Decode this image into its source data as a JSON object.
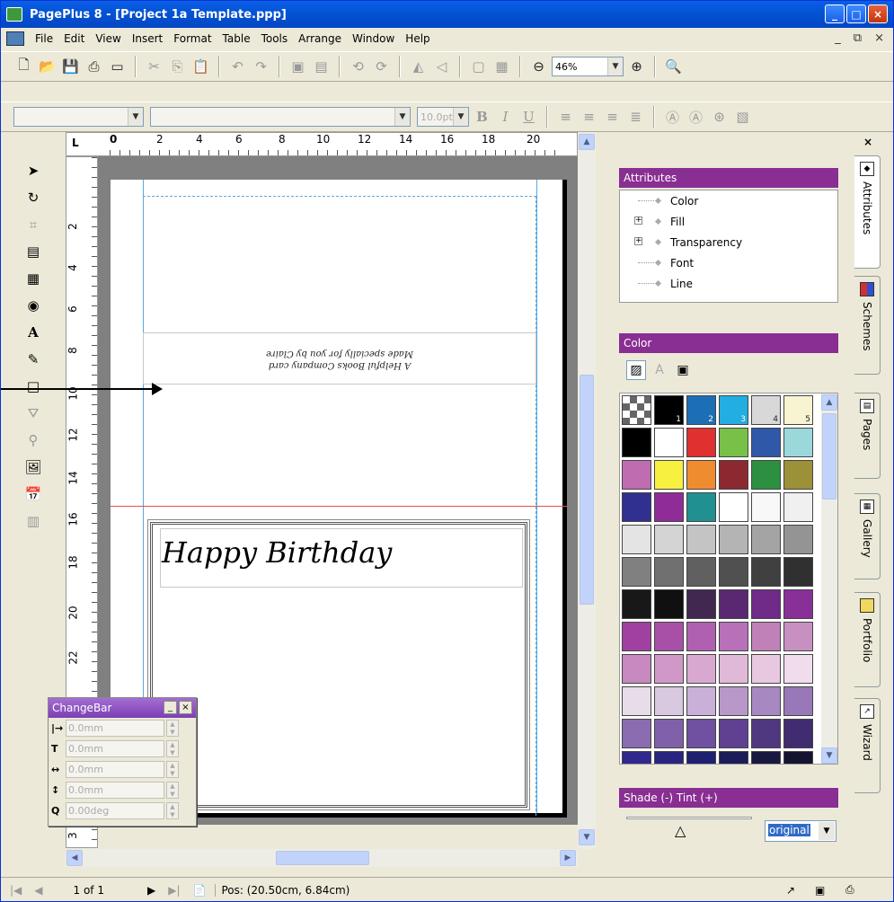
{
  "window": {
    "title": "PagePlus 8 - [Project 1a Template.ppp]",
    "btn_min": "_",
    "btn_max": "□",
    "btn_close": "×"
  },
  "menu": {
    "items": [
      "File",
      "Edit",
      "View",
      "Insert",
      "Format",
      "Table",
      "Tools",
      "Arrange",
      "Window",
      "Help"
    ],
    "right_min": "_",
    "right_restore": "⧉",
    "right_close": "×"
  },
  "toolbar": {
    "zoom": "46%"
  },
  "format_bar": {
    "font_size": "10.0pt",
    "bold": "B",
    "italic": "I",
    "underline": "U"
  },
  "ruler": {
    "h": [
      "0",
      "2",
      "4",
      "6",
      "8",
      "10",
      "12",
      "14",
      "16",
      "18",
      "20"
    ],
    "v": [
      "2",
      "4",
      "6",
      "8",
      "10",
      "12",
      "14",
      "16",
      "18",
      "20",
      "22",
      "3"
    ],
    "corner": "L"
  },
  "document": {
    "small_text_line1": "A Helpful Books Company card",
    "small_text_line2": "Made specially for you by Claire",
    "heading": "Happy Birthday"
  },
  "changebar": {
    "title": "ChangeBar",
    "fields": [
      {
        "icon": "|→",
        "value": "0.0mm"
      },
      {
        "icon": "T",
        "value": "0.0mm"
      },
      {
        "icon": "↔",
        "value": "0.0mm"
      },
      {
        "icon": "↕",
        "value": "0.0mm"
      },
      {
        "icon": "Q",
        "value": "0.00deg"
      }
    ]
  },
  "attributes_panel": {
    "title": "Attributes",
    "items": [
      "Color",
      "Fill",
      "Transparency",
      "Font",
      "Line"
    ]
  },
  "color_panel": {
    "title": "Color",
    "swatches": [
      {
        "c": "#808080",
        "n": ""
      },
      {
        "c": "#000000",
        "n": "1"
      },
      {
        "c": "#1c6fb5",
        "n": "2"
      },
      {
        "c": "#22aee0",
        "n": "3"
      },
      {
        "c": "#d8d8d8",
        "n": "4"
      },
      {
        "c": "#f8f3d0",
        "n": "5"
      },
      {
        "c": "#000000",
        "n": ""
      },
      {
        "c": "#ffffff",
        "n": ""
      },
      {
        "c": "#e03030",
        "n": ""
      },
      {
        "c": "#78c048",
        "n": ""
      },
      {
        "c": "#2f58a8",
        "n": ""
      },
      {
        "c": "#9ad8dc",
        "n": ""
      },
      {
        "c": "#c06cb0",
        "n": ""
      },
      {
        "c": "#f8f040",
        "n": ""
      },
      {
        "c": "#f08c30",
        "n": ""
      },
      {
        "c": "#8c2830",
        "n": ""
      },
      {
        "c": "#2c9040",
        "n": ""
      },
      {
        "c": "#9c9038",
        "n": ""
      },
      {
        "c": "#303090",
        "n": ""
      },
      {
        "c": "#902c98",
        "n": ""
      },
      {
        "c": "#209090",
        "n": ""
      },
      {
        "c": "#ffffff",
        "n": ""
      },
      {
        "c": "#f8f8f8",
        "n": ""
      },
      {
        "c": "#f0f0f0",
        "n": ""
      },
      {
        "c": "#e4e4e4",
        "n": ""
      },
      {
        "c": "#d4d4d4",
        "n": ""
      },
      {
        "c": "#c4c4c4",
        "n": ""
      },
      {
        "c": "#b4b4b4",
        "n": ""
      },
      {
        "c": "#a4a4a4",
        "n": ""
      },
      {
        "c": "#949494",
        "n": ""
      },
      {
        "c": "#808080",
        "n": ""
      },
      {
        "c": "#707070",
        "n": ""
      },
      {
        "c": "#606060",
        "n": ""
      },
      {
        "c": "#505050",
        "n": ""
      },
      {
        "c": "#404040",
        "n": ""
      },
      {
        "c": "#303030",
        "n": ""
      },
      {
        "c": "#181818",
        "n": ""
      },
      {
        "c": "#101010",
        "n": ""
      },
      {
        "c": "#402850",
        "n": ""
      },
      {
        "c": "#5a2870",
        "n": ""
      },
      {
        "c": "#702a88",
        "n": ""
      },
      {
        "c": "#883098",
        "n": ""
      },
      {
        "c": "#a040a0",
        "n": ""
      },
      {
        "c": "#a850a8",
        "n": ""
      },
      {
        "c": "#b060b0",
        "n": ""
      },
      {
        "c": "#b870b8",
        "n": ""
      },
      {
        "c": "#c080b8",
        "n": ""
      },
      {
        "c": "#c890c0",
        "n": ""
      },
      {
        "c": "#c888c0",
        "n": ""
      },
      {
        "c": "#d098c8",
        "n": ""
      },
      {
        "c": "#d8a8d0",
        "n": ""
      },
      {
        "c": "#e0b8d8",
        "n": ""
      },
      {
        "c": "#e8c8e0",
        "n": ""
      },
      {
        "c": "#f0dcec",
        "n": ""
      },
      {
        "c": "#e8dce8",
        "n": ""
      },
      {
        "c": "#d8c8e0",
        "n": ""
      },
      {
        "c": "#c8b0d8",
        "n": ""
      },
      {
        "c": "#b898c8",
        "n": ""
      },
      {
        "c": "#a888c0",
        "n": ""
      },
      {
        "c": "#9878b8",
        "n": ""
      },
      {
        "c": "#8c6cb0",
        "n": ""
      },
      {
        "c": "#8060a8",
        "n": ""
      },
      {
        "c": "#7050a0",
        "n": ""
      },
      {
        "c": "#604090",
        "n": ""
      },
      {
        "c": "#503880",
        "n": ""
      },
      {
        "c": "#402c70",
        "n": ""
      },
      {
        "c": "#30288c",
        "n": ""
      },
      {
        "c": "#282480",
        "n": ""
      },
      {
        "c": "#202070",
        "n": ""
      },
      {
        "c": "#1c1c58",
        "n": ""
      },
      {
        "c": "#181840",
        "n": ""
      },
      {
        "c": "#141430",
        "n": ""
      }
    ]
  },
  "shade_panel": {
    "title": "Shade (-) Tint (+)",
    "value": "original"
  },
  "side_tabs": [
    "Attributes",
    "Schemes",
    "Pages",
    "Gallery",
    "Portfolio",
    "Wizard"
  ],
  "status": {
    "page": "1 of 1",
    "pos": "Pos: (20.50cm, 6.84cm)"
  }
}
